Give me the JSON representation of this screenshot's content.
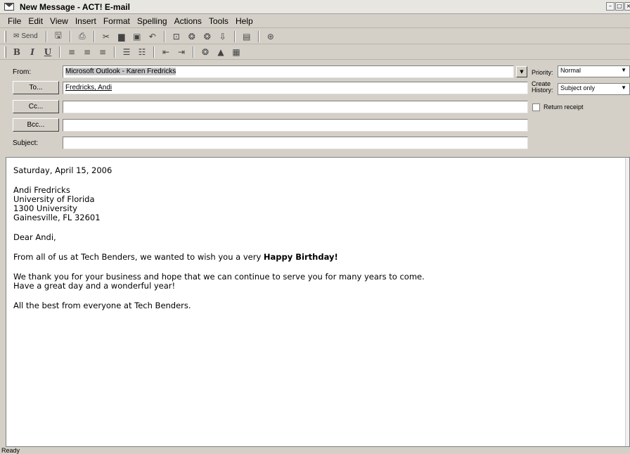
{
  "window": {
    "title": "New Message - ACT! E-mail"
  },
  "menu": [
    "File",
    "Edit",
    "View",
    "Insert",
    "Format",
    "Spelling",
    "Actions",
    "Tools",
    "Help"
  ],
  "toolbar": {
    "send_label": "Send"
  },
  "format_toolbar": {
    "bold": "B",
    "italic": "I",
    "underline": "U"
  },
  "header": {
    "from_label": "From:",
    "from_value": "Microsoft Outlook - Karen Fredricks",
    "to_button": "To...",
    "to_value": "Fredricks, Andi",
    "cc_button": "Cc...",
    "cc_value": "",
    "bcc_button": "Bcc...",
    "bcc_value": "",
    "subject_label": "Subject:",
    "subject_value": ""
  },
  "options": {
    "priority_label": "Priority:",
    "priority_value": "Normal",
    "history_label_1": "Create",
    "history_label_2": "History:",
    "history_value": "Subject only",
    "return_receipt_label": "Return receipt",
    "return_receipt_checked": false
  },
  "message": {
    "date": "Saturday, April 15, 2006",
    "address": [
      "Andi Fredricks",
      "University of Florida",
      "1300 University",
      "Gainesville, FL 32601"
    ],
    "greeting": "Dear Andi,",
    "para1_text": "From all of us at Tech Benders, we wanted to wish you a very ",
    "para1_bold": "Happy Birthday!",
    "para2_line1": "We thank you for your business and hope that we can continue to serve you for many years to come.",
    "para2_line2": "Have a great day and a wonderful year!",
    "closing": "All the best from everyone at Tech Benders."
  },
  "status": {
    "text": "Ready"
  }
}
